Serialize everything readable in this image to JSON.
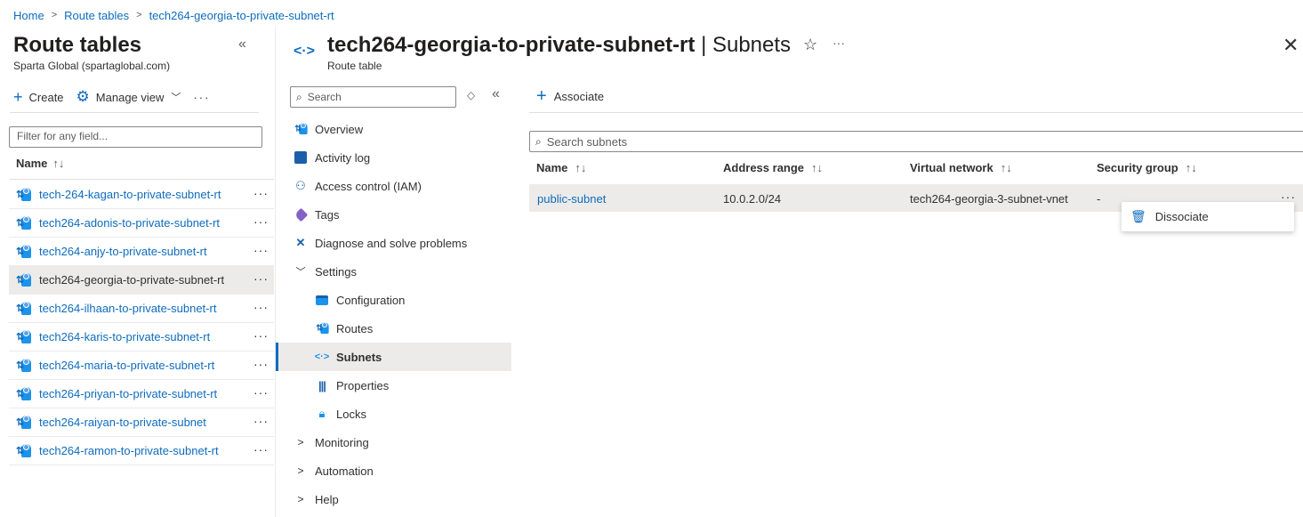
{
  "breadcrumb": [
    "Home",
    "Route tables",
    "tech264-georgia-to-private-subnet-rt"
  ],
  "left_blade": {
    "title": "Route tables",
    "subtitle": "Sparta Global (spartaglobal.com)",
    "toolbar": {
      "create": "Create",
      "manage_view": "Manage view"
    },
    "filter_placeholder": "Filter for any field...",
    "column_name": "Name",
    "items": [
      "tech-264-kagan-to-private-subnet-rt",
      "tech264-adonis-to-private-subnet-rt",
      "tech264-anjy-to-private-subnet-rt",
      "tech264-georgia-to-private-subnet-rt",
      "tech264-ilhaan-to-private-subnet-rt",
      "tech264-karis-to-private-subnet-rt",
      "tech264-maria-to-private-subnet-rt",
      "tech264-priyan-to-private-subnet-rt",
      "tech264-raiyan-to-private-subnet",
      "tech264-ramon-to-private-subnet-rt"
    ],
    "selected_index": 3
  },
  "header": {
    "resource_name": "tech264-georgia-to-private-subnet-rt",
    "pipe": "|",
    "section": "Subnets",
    "resource_type": "Route table"
  },
  "menu": {
    "search_placeholder": "Search",
    "items": [
      {
        "label": "Overview",
        "icon": "overview-icon"
      },
      {
        "label": "Activity log",
        "icon": "activity-log-icon"
      },
      {
        "label": "Access control (IAM)",
        "icon": "iam-icon"
      },
      {
        "label": "Tags",
        "icon": "tag-icon"
      },
      {
        "label": "Diagnose and solve problems",
        "icon": "wrench-icon"
      },
      {
        "label": "Settings",
        "icon": "chevron-down-icon"
      },
      {
        "label": "Configuration",
        "icon": "configuration-icon"
      },
      {
        "label": "Routes",
        "icon": "routes-icon"
      },
      {
        "label": "Subnets",
        "icon": "subnets-icon"
      },
      {
        "label": "Properties",
        "icon": "properties-icon"
      },
      {
        "label": "Locks",
        "icon": "lock-icon"
      },
      {
        "label": "Monitoring",
        "icon": "chevron-right-icon"
      },
      {
        "label": "Automation",
        "icon": "chevron-right-icon"
      },
      {
        "label": "Help",
        "icon": "chevron-right-icon"
      }
    ]
  },
  "content": {
    "associate": "Associate",
    "search_placeholder": "Search subnets",
    "columns": [
      "Name",
      "Address range",
      "Virtual network",
      "Security group"
    ],
    "rows": [
      {
        "name": "public-subnet",
        "address_range": "10.0.2.0/24",
        "virtual_network": "tech264-georgia-3-subnet-vnet",
        "security_group": "-"
      }
    ],
    "context_menu": {
      "dissociate": "Dissociate"
    }
  },
  "colors": {
    "accent": "#0f6cbd",
    "selected_bg": "#edebe9"
  }
}
